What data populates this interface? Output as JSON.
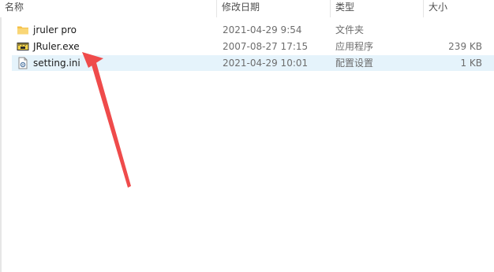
{
  "columns": {
    "name": "名称",
    "date": "修改日期",
    "type": "类型",
    "size": "大小"
  },
  "files": [
    {
      "name": "jruler pro",
      "date": "2021-04-29 9:54",
      "type": "文件夹",
      "size": "",
      "icon": "folder-icon"
    },
    {
      "name": "JRuler.exe",
      "date": "2007-08-27 17:15",
      "type": "应用程序",
      "size": "239 KB",
      "icon": "ruler-app-icon"
    },
    {
      "name": "setting.ini",
      "date": "2021-04-29 10:01",
      "type": "配置设置",
      "size": "1 KB",
      "icon": "settings-file-icon"
    }
  ],
  "selected_row": 2,
  "colors": {
    "selection": "#e5f3fb",
    "annotation_arrow": "#ef4b4b",
    "folder": "#f7c95c"
  }
}
